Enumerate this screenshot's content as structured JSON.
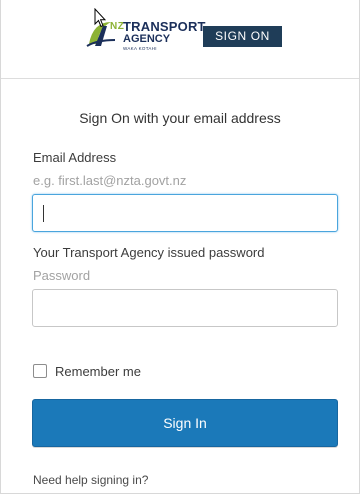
{
  "header": {
    "brand_nz": "NZ",
    "brand_line1": "TRANSPORT",
    "brand_line2": "AGENCY",
    "brand_tagline": "WAKA KOTAHI",
    "badge_text": "SIGN ON"
  },
  "form": {
    "title": "Sign On with your email address",
    "email": {
      "label": "Email Address",
      "hint": "e.g. first.last@nzta.govt.nz",
      "value": ""
    },
    "password": {
      "label": "Your Transport Agency issued password",
      "hint": "Password",
      "value": ""
    },
    "remember_label": "Remember me",
    "remember_checked": false,
    "submit_label": "Sign In",
    "help_link": "Need help signing in?"
  },
  "colors": {
    "primary_button": "#1b79b9",
    "badge_background": "#1f3d58",
    "focus_border": "#4aa5dd",
    "brand_navy": "#1b2f5a",
    "brand_green": "#8cb234"
  },
  "icons": {
    "logo": "nzta-logo-icon",
    "cursor": "mouse-pointer-icon",
    "checkbox": "checkbox-unchecked-icon"
  }
}
